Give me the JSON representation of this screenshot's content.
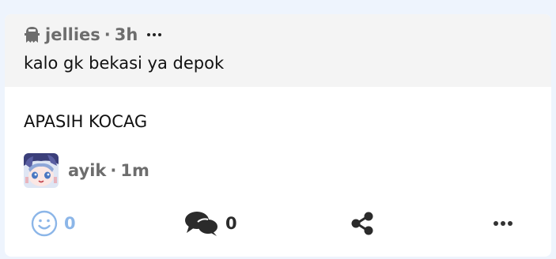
{
  "quoted_post": {
    "author": "jellies",
    "separator": "·",
    "time": "3h",
    "text": "kalo gk bekasi ya depok",
    "author_icon": "ghost-icon"
  },
  "post": {
    "text": "APASIH KOCAG",
    "author": "ayik",
    "separator": "·",
    "time": "1m"
  },
  "actions": {
    "react_count": "0",
    "comment_count": "0",
    "react_icon": "smiley-icon",
    "comment_icon": "speech-bubbles-icon",
    "share_icon": "share-icon",
    "more_icon": "more-dots-icon"
  },
  "colors": {
    "background": "#eef4fd",
    "quote_bg": "#f4f4f4",
    "muted_text": "#6d6d6d",
    "react_accent": "#8cb6e8"
  }
}
